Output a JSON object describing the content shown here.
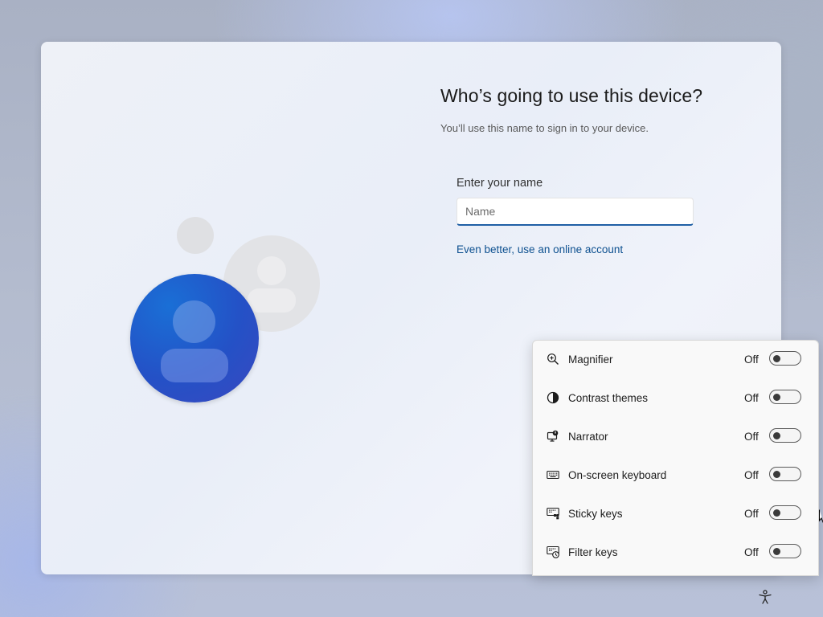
{
  "setup": {
    "title": "Who’s going to use this device?",
    "subtitle": "You’ll use this name to sign in to your device.",
    "name_label": "Enter your name",
    "name_placeholder": "Name",
    "name_value": "",
    "online_account_link": "Even better, use an online account",
    "accent_color": "#1f5fa5",
    "link_color": "#0e5190"
  },
  "accessibility_flyout": {
    "items": [
      {
        "label": "Magnifier",
        "state": "Off",
        "icon": "magnifier-icon"
      },
      {
        "label": "Contrast themes",
        "state": "Off",
        "icon": "contrast-icon"
      },
      {
        "label": "Narrator",
        "state": "Off",
        "icon": "narrator-icon"
      },
      {
        "label": "On-screen keyboard",
        "state": "Off",
        "icon": "keyboard-icon"
      },
      {
        "label": "Sticky keys",
        "state": "Off",
        "icon": "sticky-keys-icon"
      },
      {
        "label": "Filter keys",
        "state": "Off",
        "icon": "filter-keys-icon"
      }
    ]
  },
  "taskbar": {
    "accessibility_button_icon": "accessibility-icon"
  }
}
